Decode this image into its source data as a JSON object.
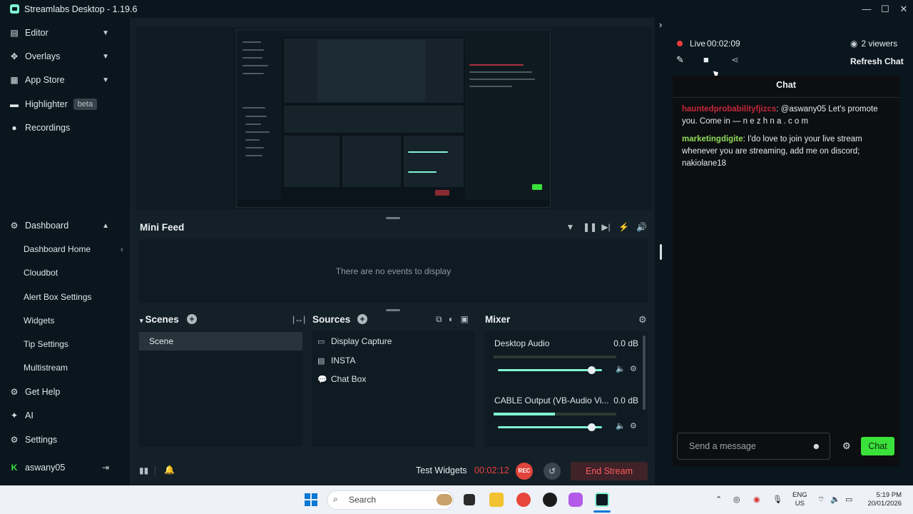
{
  "window": {
    "title": "Streamlabs Desktop - 1.19.6",
    "controls": [
      "—",
      "☐",
      "✕"
    ]
  },
  "sidebar": {
    "items": [
      {
        "label": "Editor",
        "icon": "editor-icon"
      },
      {
        "label": "Overlays",
        "icon": "overlays-icon"
      },
      {
        "label": "App Store",
        "icon": "app-store-icon"
      },
      {
        "label": "Highlighter",
        "icon": "highlighter-icon",
        "badge": "beta"
      },
      {
        "label": "Recordings",
        "icon": "recordings-icon"
      }
    ],
    "dashboard": {
      "label": "Dashboard",
      "children": [
        "Dashboard Home",
        "Cloudbot",
        "Alert Box Settings",
        "Widgets",
        "Tip Settings",
        "Multistream"
      ]
    },
    "bottom": [
      {
        "label": "Get Help",
        "icon": "help-icon"
      },
      {
        "label": "AI",
        "icon": "ai-sparkle-icon"
      },
      {
        "label": "Settings",
        "icon": "gear-icon"
      }
    ],
    "user": {
      "name": "aswany05"
    }
  },
  "minifeed": {
    "title": "Mini Feed",
    "empty_text": "There are no events to display"
  },
  "scenes": {
    "title": "Scenes",
    "items": [
      "Scene"
    ]
  },
  "sources": {
    "title": "Sources",
    "items": [
      "Display Capture",
      "INSTA",
      "Chat Box"
    ]
  },
  "mixer": {
    "title": "Mixer",
    "channels": [
      {
        "name": "Desktop Audio",
        "db": "0.0 dB",
        "meter_level": 0.0,
        "volume": 0.9
      },
      {
        "name": "CABLE Output (VB-Audio Vi...",
        "db": "0.0 dB",
        "meter_level": 0.5,
        "volume": 0.9
      }
    ]
  },
  "footer": {
    "test_widgets": "Test Widgets",
    "timer": "00:02:12",
    "rec": "REC",
    "end_stream": "End Stream"
  },
  "chat_panel": {
    "live_label": "Live",
    "live_time": "00:02:09",
    "viewers": "2 viewers",
    "refresh": "Refresh Chat",
    "header": "Chat",
    "messages": [
      {
        "user": "hauntedprobabilityfjizcs",
        "text": ": @aswany05 Let's promote you. Come in — n e z h n a . c o m"
      },
      {
        "user": "marketingdigite",
        "text": ": I'do love to join your live stream whenever you are streaming, add me on discord; nakiolane18"
      }
    ],
    "input_placeholder": "Send a message",
    "send_button": "Chat"
  },
  "taskbar": {
    "search": "Search",
    "lang_top": "ENG",
    "lang_bottom": "US",
    "time": "5:19 PM",
    "date": "20/01/2026"
  },
  "colors": {
    "accent": "#80f5d2",
    "live_red": "#ef3d3d",
    "chat_green": "#3be13b",
    "user1": "#c4283c",
    "user2": "#8fdc5a"
  }
}
